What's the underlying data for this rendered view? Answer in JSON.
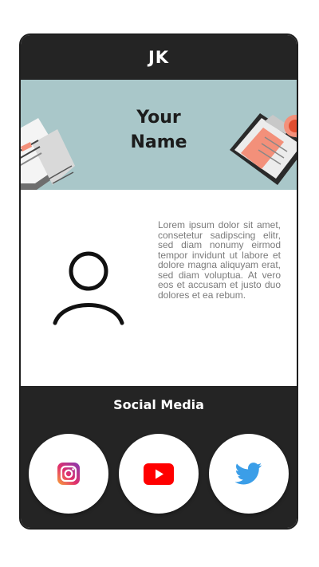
{
  "header": {
    "initials": "JK"
  },
  "banner": {
    "title_line1": "Your",
    "title_line2": "Name"
  },
  "profile": {
    "avatar_icon": "user-icon",
    "bio": "Lorem ipsum dolor sit amet, consetetur sadipscing elitr, sed diam nonumy eirmod tempor invidunt ut labore et dolore magna aliquyam erat, sed diam voluptua. At vero eos et accusam et justo duo dolores et ea rebum."
  },
  "social": {
    "title": "Social Media",
    "links": [
      {
        "icon": "instagram-icon"
      },
      {
        "icon": "youtube-icon"
      },
      {
        "icon": "twitter-icon"
      }
    ]
  },
  "colors": {
    "dark": "#242424",
    "banner": "#a9c7c9",
    "youtube": "#ff0000",
    "twitter": "#3b9ee8",
    "salmon": "#f3907a"
  }
}
